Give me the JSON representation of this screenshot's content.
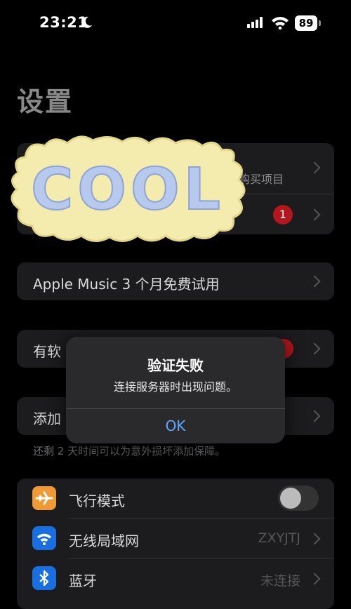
{
  "status_bar": {
    "time": "23:21",
    "battery": "89"
  },
  "page_title": "设置",
  "account_group": {
    "partial_subtitle": "购买项目",
    "badge_count": "1"
  },
  "promo_row": {
    "label": "Apple Music 3 个月免费试用"
  },
  "update_row": {
    "label_partial": "有软"
  },
  "care_row": {
    "label_partial": "添加",
    "footnote": "还剩 2 天时间可以为意外损坏添加保障。"
  },
  "connectivity": {
    "airplane_label": "飞行模式",
    "wifi_label": "无线局域网",
    "wifi_value": "ZXYJTJ",
    "bluetooth_label": "蓝牙",
    "bluetooth_value": "未连接"
  },
  "sticker": {
    "text": "COOL"
  },
  "alert": {
    "title": "验证失败",
    "message": "连接服务器时出现问题。",
    "button": "OK"
  },
  "colors": {
    "accent": "#5aa9ff",
    "badge": "#b3161d",
    "airplane_tile": "#f09a36",
    "wifi_tile": "#1a6fe0",
    "bluetooth_tile": "#1a6fe0"
  }
}
